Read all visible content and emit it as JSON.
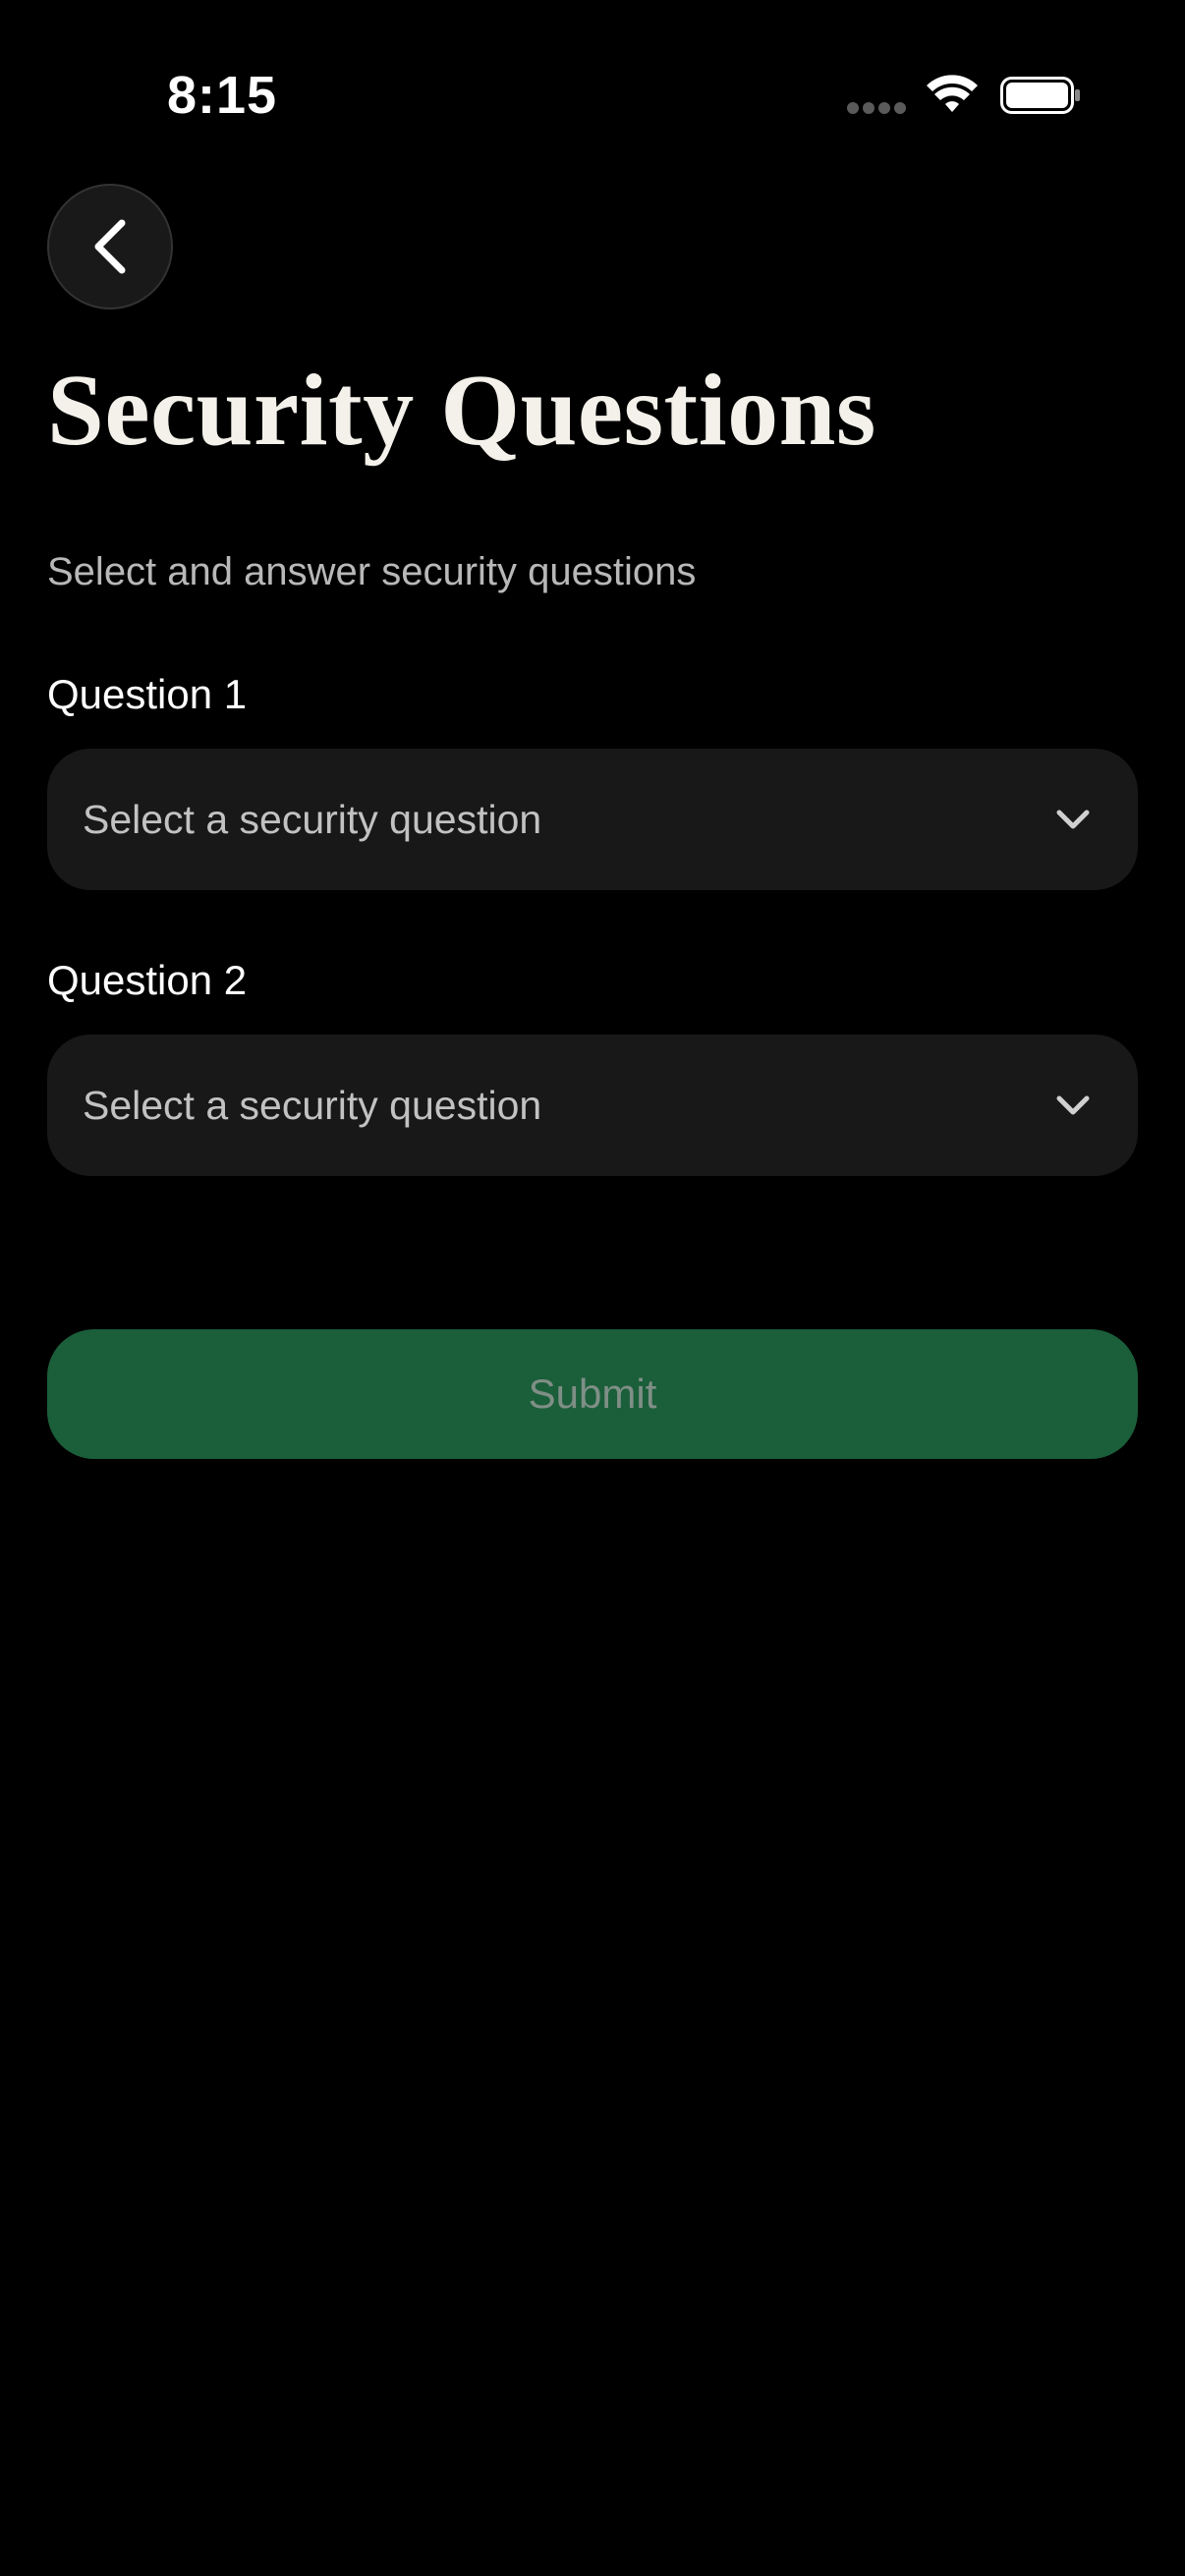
{
  "status_bar": {
    "time": "8:15"
  },
  "header": {
    "back_icon": "chevron-left-icon"
  },
  "page": {
    "title": "Security Questions",
    "subtitle": "Select and answer security questions"
  },
  "questions": [
    {
      "label": "Question 1",
      "placeholder": "Select a security question",
      "icon": "chevron-down-icon"
    },
    {
      "label": "Question 2",
      "placeholder": "Select a security question",
      "icon": "chevron-down-icon"
    }
  ],
  "actions": {
    "submit_label": "Submit"
  },
  "colors": {
    "background": "#000000",
    "field_background": "#181818",
    "submit_background": "#1b5e3a",
    "submit_text": "#7f8f86",
    "title_text": "#f3f1ea"
  }
}
